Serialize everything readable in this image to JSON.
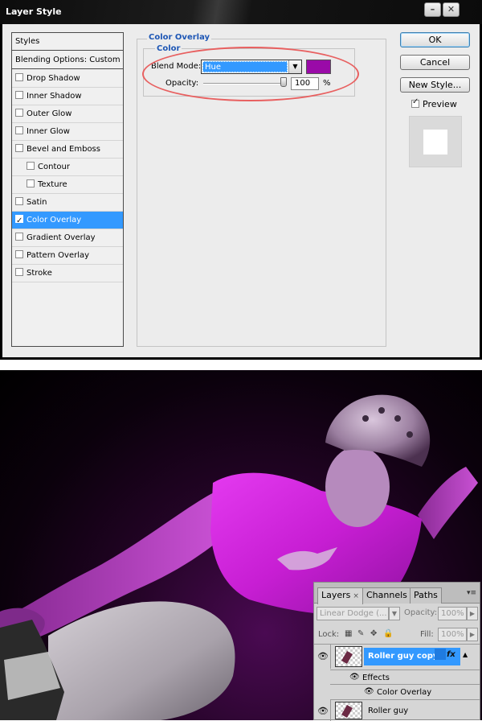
{
  "dialog": {
    "title": "Layer Style",
    "styles_list": {
      "header": "Styles",
      "blending": "Blending Options: Custom",
      "items": [
        {
          "label": "Drop Shadow",
          "checked": false
        },
        {
          "label": "Inner Shadow",
          "checked": false
        },
        {
          "label": "Outer Glow",
          "checked": false
        },
        {
          "label": "Inner Glow",
          "checked": false
        },
        {
          "label": "Bevel and Emboss",
          "checked": false
        },
        {
          "label": "Contour",
          "checked": false
        },
        {
          "label": "Texture",
          "checked": false
        },
        {
          "label": "Satin",
          "checked": false
        },
        {
          "label": "Color Overlay",
          "checked": true,
          "selected": true
        },
        {
          "label": "Gradient Overlay",
          "checked": false
        },
        {
          "label": "Pattern Overlay",
          "checked": false
        },
        {
          "label": "Stroke",
          "checked": false
        }
      ]
    },
    "panel": {
      "group_title": "Color Overlay",
      "subgroup_title": "Color",
      "blend_mode_label": "Blend Mode:",
      "blend_mode_value": "Hue",
      "overlay_color": "#9a0aa8",
      "opacity_label": "Opacity:",
      "opacity_value": "100",
      "opacity_unit": "%",
      "opacity_fraction": 1.0
    },
    "buttons": {
      "ok": "OK",
      "cancel": "Cancel",
      "new_style": "New Style...",
      "preview_label": "Preview",
      "preview_checked": true
    }
  },
  "layers_panel": {
    "tabs": [
      "Layers",
      "Channels",
      "Paths"
    ],
    "tab_close": "×",
    "blend_mode": "Linear Dodge (...",
    "opacity_label": "Opacity:",
    "opacity_value": "100%",
    "lock_label": "Lock:",
    "fill_label": "Fill:",
    "fill_value": "100%",
    "layers": [
      {
        "name": "Roller guy copy",
        "selected": true,
        "fx": "fx"
      },
      {
        "name": "Roller guy",
        "selected": false
      }
    ],
    "effects_label": "Effects",
    "effect_item": "Color Overlay"
  },
  "colors": {
    "selection_blue": "#3399ff",
    "overlay_magenta": "#c41ed0"
  }
}
